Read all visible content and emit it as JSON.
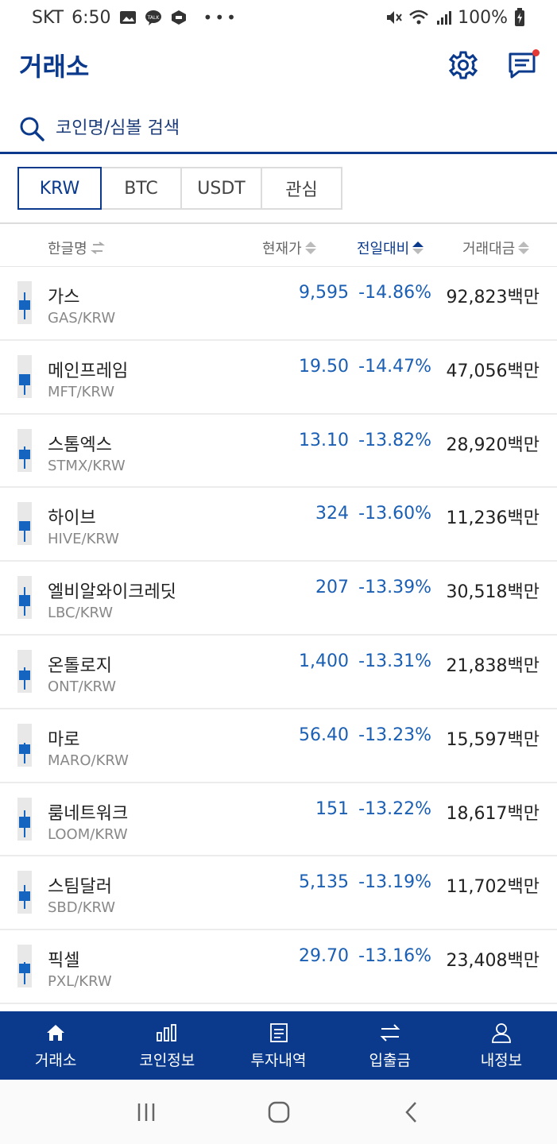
{
  "status": {
    "carrier": "SKT",
    "time": "6:50",
    "battery": "100%",
    "notification_icons": [
      "gallery-icon",
      "kakaotalk-icon",
      "app-icon"
    ]
  },
  "header": {
    "title": "거래소"
  },
  "search": {
    "placeholder": "코인명/심볼 검색"
  },
  "tabs": [
    "KRW",
    "BTC",
    "USDT",
    "관심"
  ],
  "active_tab": "KRW",
  "columns": {
    "name": "한글명",
    "price": "현재가",
    "change": "전일대비",
    "volume": "거래대금"
  },
  "sorted_column": "change",
  "coins": [
    {
      "name": "가스",
      "symbol": "GAS/KRW",
      "price": "9,595",
      "change": "-14.86%",
      "volume": "92,823백만"
    },
    {
      "name": "메인프레임",
      "symbol": "MFT/KRW",
      "price": "19.50",
      "change": "-14.47%",
      "volume": "47,056백만"
    },
    {
      "name": "스톰엑스",
      "symbol": "STMX/KRW",
      "price": "13.10",
      "change": "-13.82%",
      "volume": "28,920백만"
    },
    {
      "name": "하이브",
      "symbol": "HIVE/KRW",
      "price": "324",
      "change": "-13.60%",
      "volume": "11,236백만"
    },
    {
      "name": "엘비알와이크레딧",
      "symbol": "LBC/KRW",
      "price": "207",
      "change": "-13.39%",
      "volume": "30,518백만"
    },
    {
      "name": "온톨로지",
      "symbol": "ONT/KRW",
      "price": "1,400",
      "change": "-13.31%",
      "volume": "21,838백만"
    },
    {
      "name": "마로",
      "symbol": "MARO/KRW",
      "price": "56.40",
      "change": "-13.23%",
      "volume": "15,597백만"
    },
    {
      "name": "룸네트워크",
      "symbol": "LOOM/KRW",
      "price": "151",
      "change": "-13.22%",
      "volume": "18,617백만"
    },
    {
      "name": "스팀달러",
      "symbol": "SBD/KRW",
      "price": "5,135",
      "change": "-13.19%",
      "volume": "11,702백만"
    },
    {
      "name": "픽셀",
      "symbol": "PXL/KRW",
      "price": "29.70",
      "change": "-13.16%",
      "volume": "23,408백만"
    }
  ],
  "bottom_nav": [
    {
      "label": "거래소",
      "icon": "home-icon"
    },
    {
      "label": "코인정보",
      "icon": "bar-chart-icon"
    },
    {
      "label": "투자내역",
      "icon": "document-icon"
    },
    {
      "label": "입출금",
      "icon": "transfer-icon"
    },
    {
      "label": "내정보",
      "icon": "user-icon"
    }
  ],
  "colors": {
    "brand": "#0b3a8c",
    "fall": "#1a5fb4",
    "alert": "#e53935"
  }
}
